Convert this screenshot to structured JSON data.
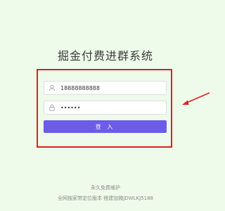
{
  "title": "掘金付费进群系统",
  "form": {
    "username_value": "18888888888",
    "password_value": "123456",
    "login_label": "登 入"
  },
  "icons": {
    "user": "user-icon",
    "lock": "lock-icon"
  },
  "colors": {
    "background": "#eefbea",
    "button": "#6d5ce8",
    "highlight": "#e02020"
  },
  "footer": {
    "line1": "永久免费维护",
    "line2": "全网独家带定位版本 搭建加微JDWLKJ5188"
  }
}
